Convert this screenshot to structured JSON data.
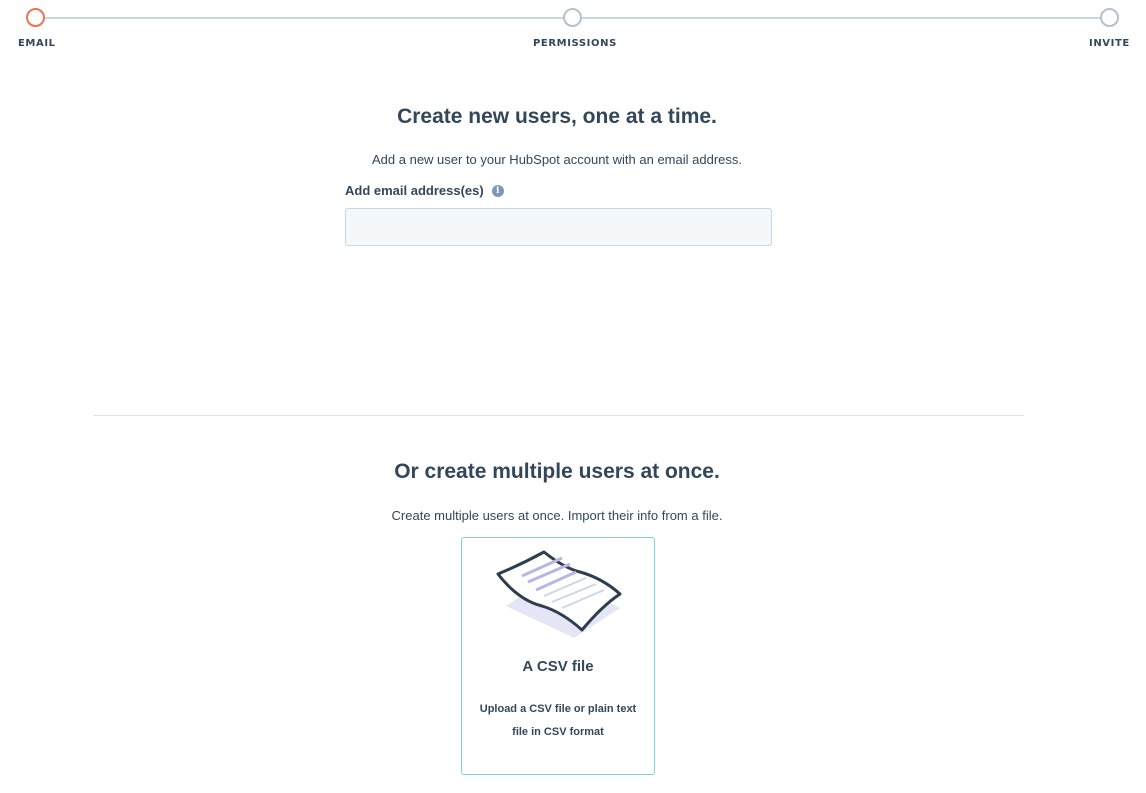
{
  "stepper": {
    "steps": [
      {
        "label": "EMAIL",
        "state": "active"
      },
      {
        "label": "PERMISSIONS",
        "state": "pending"
      },
      {
        "label": "INVITE",
        "state": "pending"
      }
    ],
    "colors": {
      "active": "#e8764f",
      "pending": "#b3c1cf",
      "line": "#cbd6e2"
    }
  },
  "single_user": {
    "title": "Create new users, one at a time.",
    "subtitle": "Add a new user to your HubSpot account with an email address.",
    "field_label": "Add email address(es)",
    "field_icon": "info-icon",
    "input_value": ""
  },
  "multiple_users": {
    "title": "Or create multiple users at once.",
    "subtitle": "Create multiple users at once. Import their info from a file.",
    "csv_card": {
      "illustration": "csv-document-icon",
      "title": "A CSV file",
      "description": "Upload a CSV file or plain text file in CSV format",
      "border_color": "#7fd1de"
    }
  }
}
